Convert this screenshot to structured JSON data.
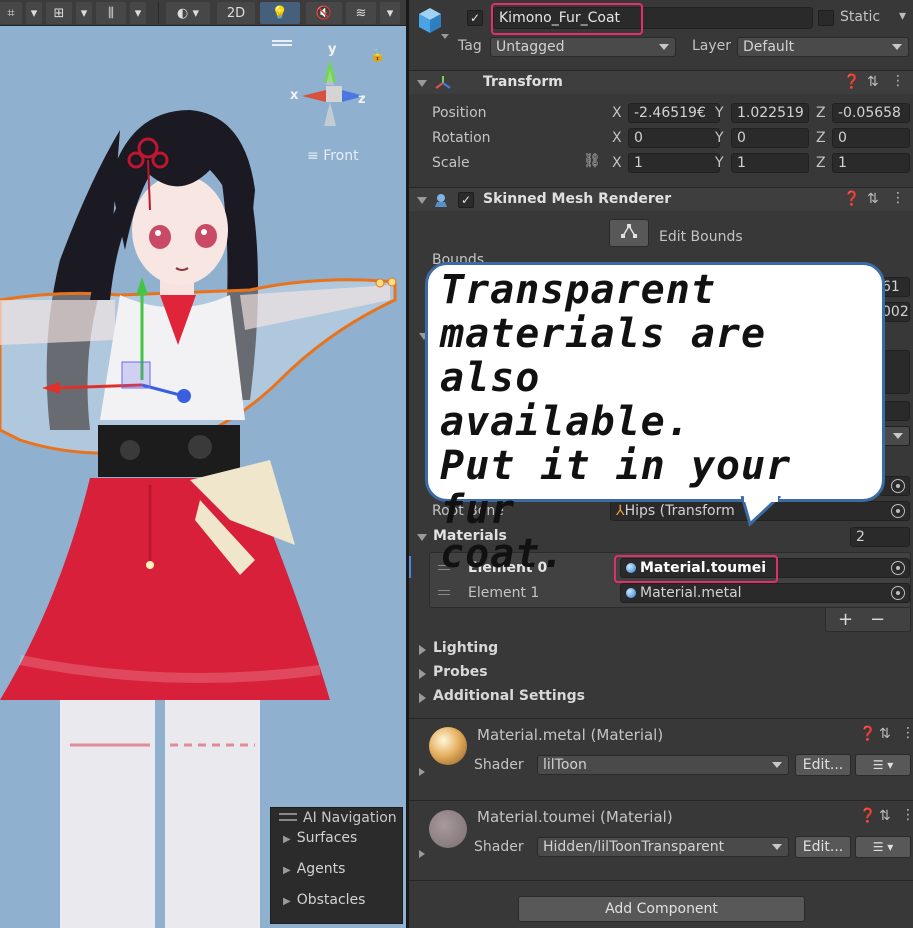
{
  "scene": {
    "toolbar": {
      "mode_2d": "2D"
    },
    "gizmo": {
      "axis_x": "x",
      "axis_y": "y",
      "axis_z": "z",
      "view_label": "Front"
    },
    "ai_navigation": {
      "title": "AI Navigation",
      "items": [
        "Surfaces",
        "Agents",
        "Obstacles"
      ]
    }
  },
  "inspector": {
    "object": {
      "name": "Kimono_Fur_Coat",
      "active": true,
      "static_label": "Static",
      "tag_label": "Tag",
      "tag_value": "Untagged",
      "layer_label": "Layer",
      "layer_value": "Default"
    },
    "transform": {
      "title": "Transform",
      "position": {
        "label": "Position",
        "x": "-2.46519€",
        "y": "1.022519",
        "z": "-0.05658"
      },
      "rotation": {
        "label": "Rotation",
        "x": "0",
        "y": "0",
        "z": "0"
      },
      "scale": {
        "label": "Scale",
        "x": "1",
        "y": "1",
        "z": "1"
      },
      "axis_labels": [
        "X",
        "Y",
        "Z"
      ]
    },
    "skinned_mesh_renderer": {
      "title": "Skinned Mesh Renderer",
      "edit_bounds_label": "Edit Bounds",
      "bounds_label": "Bounds",
      "partial_values": [
        "61",
        "002"
      ],
      "root_bone_label": "Root Bone",
      "root_bone_value": "Hips (Transform",
      "materials_label": "Materials",
      "materials_count": "2",
      "elements": [
        {
          "label": "Element 0",
          "value": "Material.toumei"
        },
        {
          "label": "Element 1",
          "value": "Material.metal"
        }
      ],
      "add_label": "+",
      "remove_label": "−",
      "sections": [
        "Lighting",
        "Probes",
        "Additional Settings"
      ]
    },
    "materials": [
      {
        "name": "Material.metal (Material)",
        "shader_label": "Shader",
        "shader_value": "lilToon",
        "edit_label": "Edit..."
      },
      {
        "name": "Material.toumei (Material)",
        "shader_label": "Shader",
        "shader_value": "Hidden/lilToonTransparent",
        "edit_label": "Edit..."
      }
    ],
    "add_component_label": "Add Component"
  },
  "callout": {
    "text_lines": [
      "Transparent",
      "materials are also",
      "available.",
      "Put it in your fur",
      "coat."
    ]
  },
  "colors": {
    "highlight": "#e0306a",
    "bubble_border": "#3b6ba5",
    "scene_background": "#8fb0cf",
    "kimono_red": "#d8203a"
  }
}
